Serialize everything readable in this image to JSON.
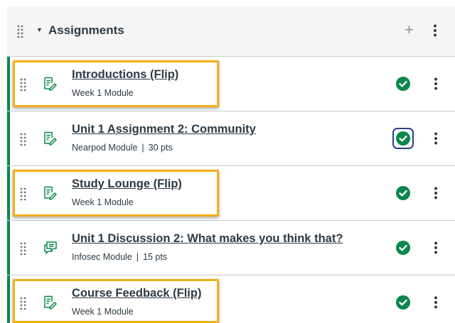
{
  "module": {
    "title": "Assignments",
    "header_icons": {
      "drag": "drag-handle-icon",
      "caret": "caret-down-icon",
      "add": "plus-icon",
      "more": "kebab-icon"
    }
  },
  "items": [
    {
      "title": "Introductions (Flip)",
      "meta_module": "Week 1 Module",
      "meta_points": "",
      "type_icon": "assignment-icon",
      "status_icon": "published-check-icon",
      "highlighted": true
    },
    {
      "title": "Unit 1 Assignment 2: Community",
      "meta_module": "Nearpod Module",
      "meta_points": "30 pts",
      "type_icon": "assignment-icon",
      "status_icon": "published-check-icon",
      "highlighted": false,
      "focused": true
    },
    {
      "title": "Study Lounge (Flip)",
      "meta_module": "Week 1 Module",
      "meta_points": "",
      "type_icon": "assignment-icon",
      "status_icon": "published-check-icon",
      "highlighted": true
    },
    {
      "title": "Unit 1 Discussion 2: What makes you think that?",
      "meta_module": "Infosec Module",
      "meta_points": "15 pts",
      "type_icon": "discussion-icon",
      "status_icon": "published-check-icon",
      "highlighted": false
    },
    {
      "title": "Course Feedback (Flip)",
      "meta_module": "Week 1 Module",
      "meta_points": "",
      "type_icon": "assignment-icon",
      "status_icon": "published-check-icon",
      "highlighted": true
    }
  ],
  "colors": {
    "published": "#0b874b",
    "highlight": "#f5b01a",
    "focus": "#2b3d8c",
    "text": "#2d3b45"
  }
}
